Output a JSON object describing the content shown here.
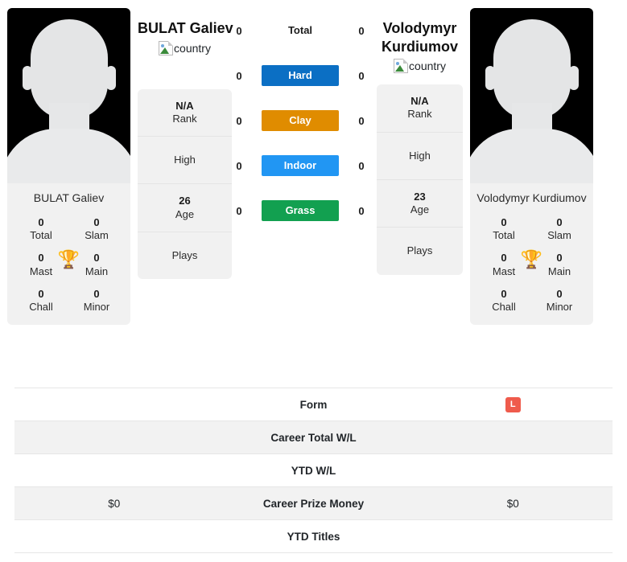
{
  "players": {
    "left": {
      "name": "BULAT Galiev",
      "photo_caption": "BULAT Galiev",
      "country_alt": "country",
      "rank_value": "N/A",
      "rank_label": "Rank",
      "high_label": "High",
      "age_value": "26",
      "age_label": "Age",
      "plays_label": "Plays",
      "titles": [
        {
          "num": "0",
          "label": "Total"
        },
        {
          "num": "0",
          "label": "Slam"
        },
        {
          "num": "0",
          "label": "Mast"
        },
        {
          "num": "0",
          "label": "Main"
        },
        {
          "num": "0",
          "label": "Chall"
        },
        {
          "num": "0",
          "label": "Minor"
        }
      ]
    },
    "right": {
      "name": "Volodymyr Kurdiumov",
      "photo_caption": "Volodymyr Kurdiumov",
      "country_alt": "country",
      "rank_value": "N/A",
      "rank_label": "Rank",
      "high_label": "High",
      "age_value": "23",
      "age_label": "Age",
      "plays_label": "Plays",
      "titles": [
        {
          "num": "0",
          "label": "Total"
        },
        {
          "num": "0",
          "label": "Slam"
        },
        {
          "num": "0",
          "label": "Mast"
        },
        {
          "num": "0",
          "label": "Main"
        },
        {
          "num": "0",
          "label": "Chall"
        },
        {
          "num": "0",
          "label": "Minor"
        }
      ]
    }
  },
  "surfaces": [
    {
      "label": "Total",
      "left": "0",
      "right": "0",
      "color": "none"
    },
    {
      "label": "Hard",
      "left": "0",
      "right": "0",
      "color": "#0b6fc4"
    },
    {
      "label": "Clay",
      "left": "0",
      "right": "0",
      "color": "#e08c00"
    },
    {
      "label": "Indoor",
      "left": "0",
      "right": "0",
      "color": "#2196f3"
    },
    {
      "label": "Grass",
      "left": "0",
      "right": "0",
      "color": "#12a050"
    }
  ],
  "comparison_rows": [
    {
      "label": "Form",
      "left": "",
      "right": "L",
      "right_is_badge": true,
      "shaded": false
    },
    {
      "label": "Career Total W/L",
      "left": "",
      "right": "",
      "right_is_badge": false,
      "shaded": true
    },
    {
      "label": "YTD W/L",
      "left": "",
      "right": "",
      "right_is_badge": false,
      "shaded": false
    },
    {
      "label": "Career Prize Money",
      "left": "$0",
      "right": "$0",
      "right_is_badge": false,
      "shaded": true
    },
    {
      "label": "YTD Titles",
      "left": "",
      "right": "",
      "right_is_badge": false,
      "shaded": false
    }
  ],
  "colors": {
    "form_loss": "#ef5b4c",
    "trophy": "#3a6ea5",
    "panel_bg": "#f1f1f1",
    "row_shade": "#f2f2f2"
  },
  "icons": {
    "trophy": "🏆"
  }
}
